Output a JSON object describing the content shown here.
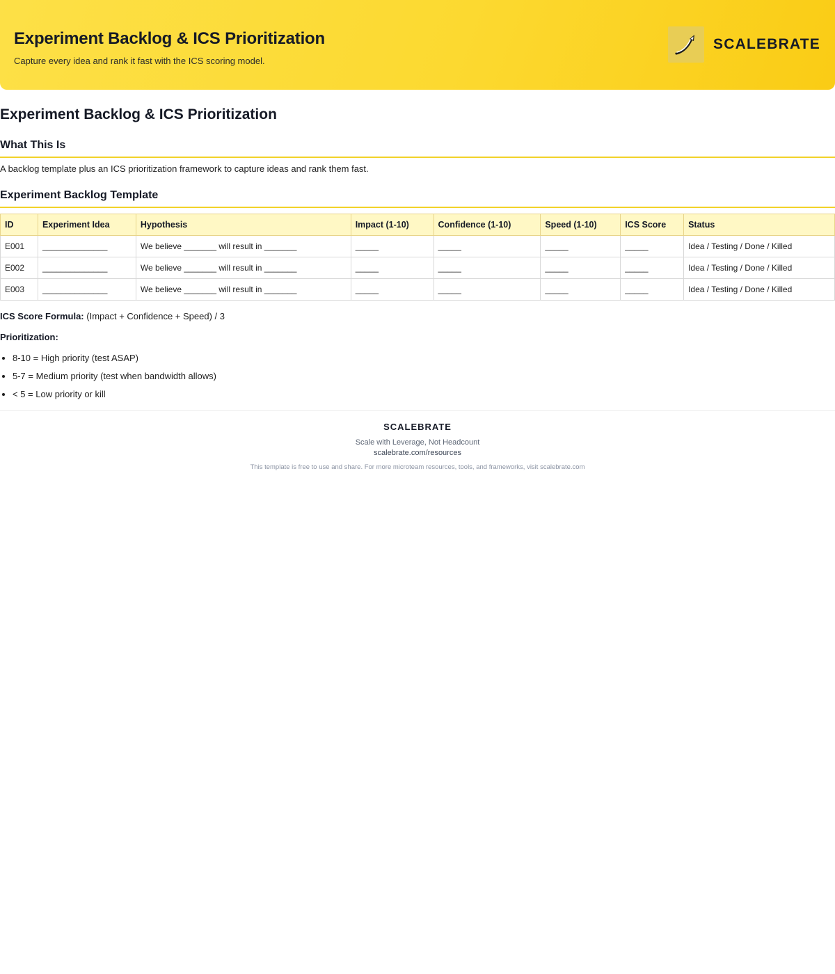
{
  "header": {
    "title": "Experiment Backlog & ICS Prioritization",
    "subtitle": "Capture every idea and rank it fast with the ICS scoring model.",
    "brand_name": "SCALEBRATE",
    "logo_icon": "rising-arrow-icon",
    "background_colors": [
      "#fde047",
      "#facc15"
    ]
  },
  "doc": {
    "title": "Experiment Backlog & ICS Prioritization",
    "what_heading": "What This Is",
    "what_text": "A backlog template plus an ICS prioritization framework to capture ideas and rank them fast.",
    "template_heading": "Experiment Backlog Template"
  },
  "table": {
    "columns": [
      "ID",
      "Experiment Idea",
      "Hypothesis",
      "Impact (1-10)",
      "Confidence (1-10)",
      "Speed (1-10)",
      "ICS Score",
      "Status"
    ],
    "rows": [
      [
        "E001",
        "______________",
        "We believe _______ will result in _______",
        "_____",
        "_____",
        "_____",
        "_____",
        "Idea / Testing / Done / Killed"
      ],
      [
        "E002",
        "______________",
        "We believe _______ will result in _______",
        "_____",
        "_____",
        "_____",
        "_____",
        "Idea / Testing / Done / Killed"
      ],
      [
        "E003",
        "______________",
        "We believe _______ will result in _______",
        "_____",
        "_____",
        "_____",
        "_____",
        "Idea / Testing / Done / Killed"
      ]
    ],
    "header_bg": "#fff8c5"
  },
  "formula": {
    "label": "ICS Score Formula:",
    "text": "(Impact + Confidence + Speed) / 3"
  },
  "prioritization": {
    "label": "Prioritization:",
    "items": [
      "8-10 = High priority (test ASAP)",
      "5-7 = Medium priority (test when bandwidth allows)",
      "< 5 = Low priority or kill"
    ]
  },
  "footer": {
    "brand": "SCALEBRATE",
    "tagline": "Scale with Leverage, Not Headcount",
    "url": "scalebrate.com/resources",
    "note": "This template is free to use and share. For more microteam resources, tools, and frameworks, visit scalebrate.com"
  },
  "accent_color": "#f2d229"
}
